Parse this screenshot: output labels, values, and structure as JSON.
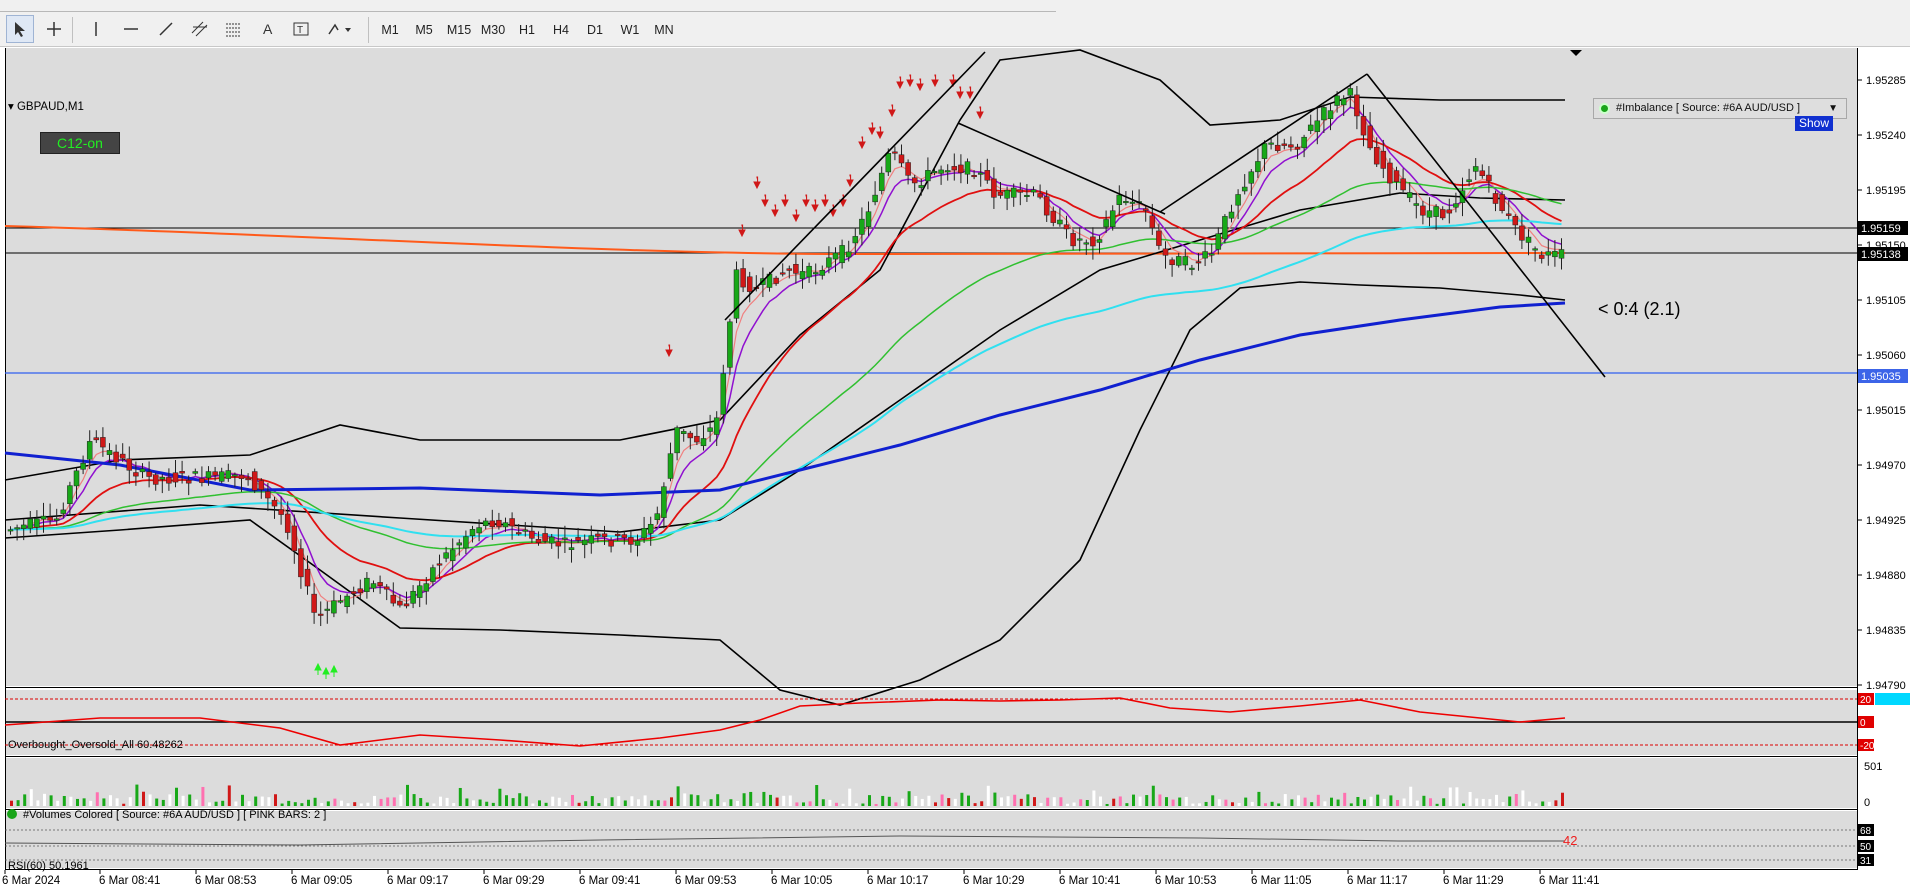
{
  "toolbar": {
    "timeframes": [
      "M1",
      "M5",
      "M15",
      "M30",
      "H1",
      "H4",
      "D1",
      "W1",
      "MN"
    ]
  },
  "chart": {
    "symbol": "GBPAUD,M1",
    "c12_button": "C12-on",
    "imbalance_label": "#Imbalance [ Source: #6A AUD/USD ]",
    "show_button": "Show",
    "ratio_label": "< 0:4 (2.1)",
    "price_labels": [
      "1.95285",
      "1.95240",
      "1.95195",
      "1.95150",
      "1.95105",
      "1.95060",
      "1.95015",
      "1.94970",
      "1.94925",
      "1.94880",
      "1.94835",
      "1.94790"
    ],
    "highlight_prices": {
      "upper": "1.95159",
      "current": "1.95138",
      "hline": "1.95035"
    },
    "time_labels": [
      "6 Mar 2024",
      "6 Mar 08:41",
      "6 Mar 08:53",
      "6 Mar 09:05",
      "6 Mar 09:17",
      "6 Mar 09:29",
      "6 Mar 09:41",
      "6 Mar 09:53",
      "6 Mar 10:05",
      "6 Mar 10:17",
      "6 Mar 10:29",
      "6 Mar 10:41",
      "6 Mar 10:53",
      "6 Mar 11:05",
      "6 Mar 11:17",
      "6 Mar 11:29",
      "6 Mar 11:41"
    ]
  },
  "oscillator": {
    "label": "Overbought_Oversold_All 60.48262",
    "levels": [
      "20",
      "0",
      "-20"
    ]
  },
  "volumes": {
    "label": "#Volumes Colored [ Source: #6A AUD/USD ]  [ PINK BARS: 2 ]",
    "scale": [
      "501",
      "0"
    ],
    "count": "42"
  },
  "rsi": {
    "label": "RSI(60) 50.1961",
    "levels": [
      "68",
      "50",
      "31"
    ]
  },
  "colors": {
    "bull": "#18a818",
    "bear": "#d01818",
    "ma_blue": "#1020d0",
    "ma_cyan": "#30e0f0",
    "ma_green": "#30c030",
    "ma_red": "#e01010",
    "ma_purple": "#9010d0",
    "ma_salmon": "#f08080",
    "trend_orange": "#ff5a1a",
    "hline_blue": "#3060f0",
    "price_tag": "#000000",
    "hline_tag": "#3c64e8"
  }
}
